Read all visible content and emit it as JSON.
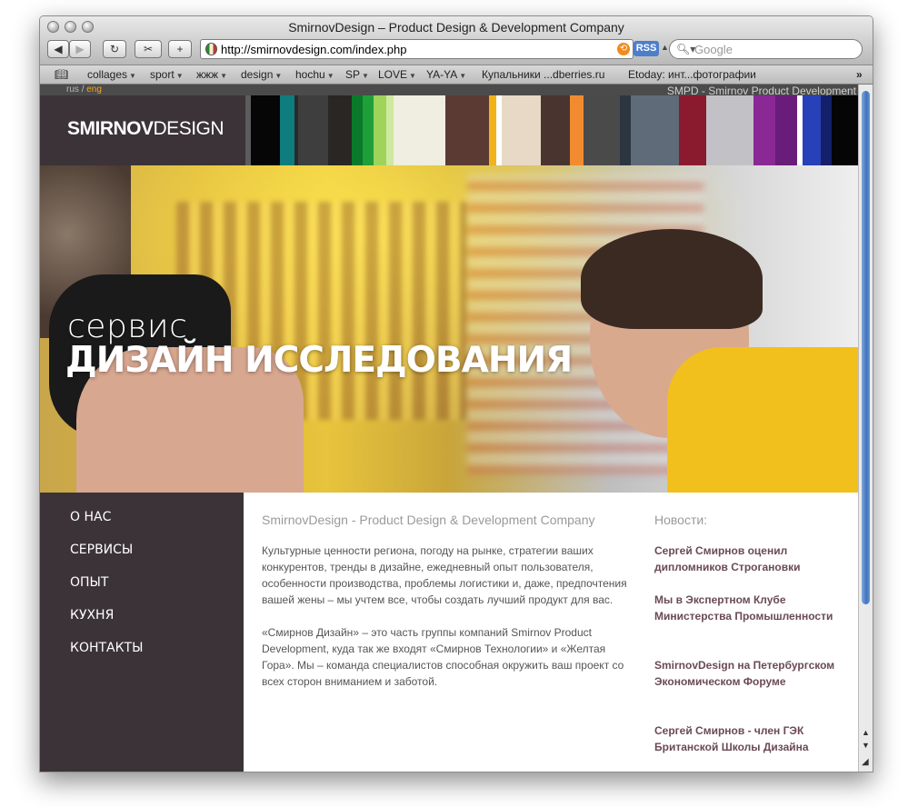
{
  "window": {
    "title": "SmirnovDesign – Product Design & Development Company",
    "url": "http://smirnovdesign.com/index.php",
    "rss_label": "RSS",
    "search_placeholder": "Google"
  },
  "bookmarks": [
    {
      "label": "collages",
      "menu": true
    },
    {
      "label": "sport",
      "menu": true
    },
    {
      "label": "жжж",
      "menu": true
    },
    {
      "label": "design",
      "menu": true
    },
    {
      "label": "hochu",
      "menu": true
    },
    {
      "label": "SP",
      "menu": true
    },
    {
      "label": "LOVE",
      "menu": true
    },
    {
      "label": "YA-YA",
      "menu": true
    },
    {
      "label": "Купальники ...dberries.ru",
      "menu": false
    },
    {
      "label": "Etoday: инт...фотографии",
      "menu": false
    }
  ],
  "site": {
    "lang_rus": "rus",
    "lang_sep": "/",
    "lang_eng": "eng",
    "tagline": "SMPD - Smirnov Product Development",
    "logo_bold": "SMIRNOV",
    "logo_light": "DESIGN",
    "hero_small": "сервис",
    "hero_big": "ДИЗАЙН ИССЛЕДОВАНИЯ",
    "nav": [
      "О НАС",
      "СЕРВИСЫ",
      "ОПЫТ",
      "КУХНЯ",
      "КОНТАКТЫ"
    ],
    "content_title": "SmirnovDesign - Product Design & Development Company",
    "paragraph1": "Культурные ценности региона, погоду на рынке, стратегии ваших конкурентов, тренды в дизайне, ежедневный опыт пользователя, особенности производства, проблемы логистики и, даже, предпочтения вашей жены – мы учтем все, чтобы создать лучший продукт для вас.",
    "paragraph2": "«Смирнов Дизайн» –  это часть группы компаний Smirnov Product Development, куда так же входят «Смирнов Технологии» и «Желтая Гора». Мы – команда специалистов способная окружить ваш проект со всех сторон вниманием и заботой.",
    "news_heading": "Новости:",
    "news": [
      "Сергей Смирнов оценил дипломников Строгановки",
      "Мы в Экспертном Клубе Министерства Промышленности",
      "SmirnovDesign на Петербургском Экономическом Форуме",
      "Сергей Смирнов - член ГЭК Британской Школы Дизайна"
    ]
  },
  "colors": {
    "sidebar_bg": "#3b3337",
    "lang_active": "#f5a623",
    "news_link": "#6a4a55"
  }
}
